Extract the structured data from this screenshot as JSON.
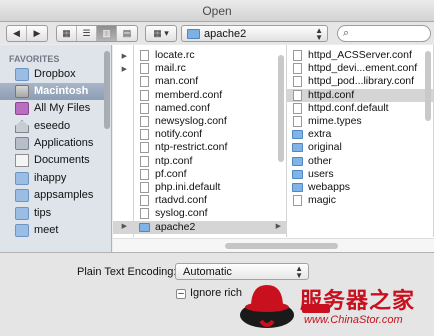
{
  "window": {
    "title": "Open"
  },
  "toolbar": {
    "view_modes": [
      "icon-view",
      "list-view",
      "column-view",
      "coverflow-view"
    ],
    "active_view": "column-view",
    "arrange": "grid-icon",
    "path": "apache2",
    "search_placeholder": ""
  },
  "sidebar": {
    "heading": "FAVORITES",
    "items": [
      {
        "label": "Dropbox",
        "icon": "folder-icon"
      },
      {
        "label": "Macintosh",
        "icon": "disk-icon",
        "selected": true
      },
      {
        "label": "All My Files",
        "icon": "all-files-icon"
      },
      {
        "label": "eseedo",
        "icon": "home-icon"
      },
      {
        "label": "Applications",
        "icon": "applications-icon"
      },
      {
        "label": "Documents",
        "icon": "documents-icon"
      },
      {
        "label": "ihappy",
        "icon": "folder-icon"
      },
      {
        "label": "appsamples",
        "icon": "folder-icon"
      },
      {
        "label": "tips",
        "icon": "folder-icon"
      },
      {
        "label": "meet",
        "icon": "folder-icon"
      }
    ]
  },
  "columns": {
    "col2": [
      {
        "name": "locate.rc",
        "kind": "file"
      },
      {
        "name": "mail.rc",
        "kind": "file"
      },
      {
        "name": "man.conf",
        "kind": "file"
      },
      {
        "name": "memberd.conf",
        "kind": "file"
      },
      {
        "name": "named.conf",
        "kind": "file"
      },
      {
        "name": "newsyslog.conf",
        "kind": "file"
      },
      {
        "name": "notify.conf",
        "kind": "file"
      },
      {
        "name": "ntp-restrict.conf",
        "kind": "file"
      },
      {
        "name": "ntp.conf",
        "kind": "file"
      },
      {
        "name": "pf.conf",
        "kind": "file"
      },
      {
        "name": "php.ini.default",
        "kind": "file"
      },
      {
        "name": "rtadvd.conf",
        "kind": "file"
      },
      {
        "name": "syslog.conf",
        "kind": "file"
      },
      {
        "name": "apache2",
        "kind": "folder",
        "selected": true
      }
    ],
    "col3": [
      {
        "name": "httpd_ACSServer.conf",
        "kind": "file"
      },
      {
        "name": "httpd_devi...ement.conf",
        "kind": "file"
      },
      {
        "name": "httpd_pod...library.conf",
        "kind": "file"
      },
      {
        "name": "httpd.conf",
        "kind": "file",
        "selected": true
      },
      {
        "name": "httpd.conf.default",
        "kind": "file"
      },
      {
        "name": "mime.types",
        "kind": "file"
      },
      {
        "name": "extra",
        "kind": "folder"
      },
      {
        "name": "original",
        "kind": "folder"
      },
      {
        "name": "other",
        "kind": "folder"
      },
      {
        "name": "users",
        "kind": "folder"
      },
      {
        "name": "webapps",
        "kind": "folder"
      },
      {
        "name": "magic",
        "kind": "file"
      }
    ]
  },
  "bottom": {
    "encoding_label": "Plain Text Encoding:",
    "encoding_value": "Automatic",
    "ignore_label": "Ignore rich"
  },
  "watermark": {
    "brand": "服务器之家",
    "url": "www.ChinaStor.com"
  }
}
